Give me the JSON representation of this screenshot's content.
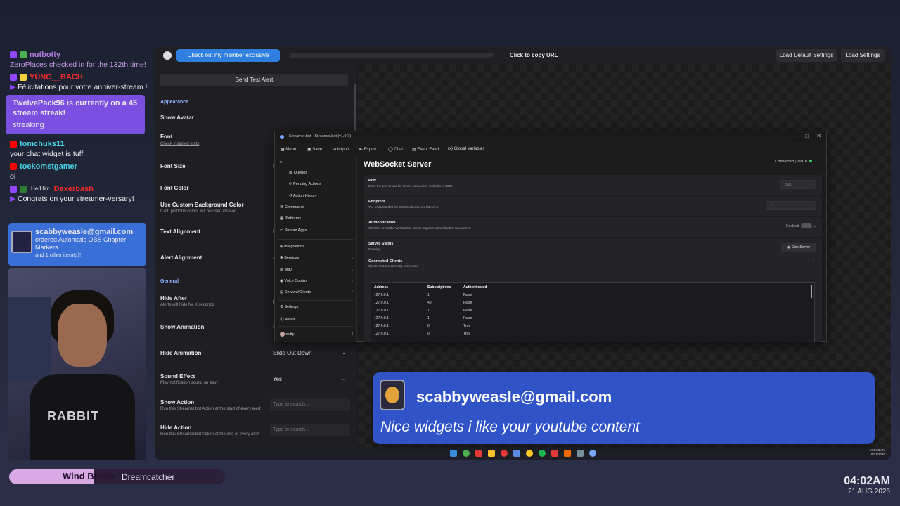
{
  "chat": {
    "messages": [
      {
        "user": "nutbotty",
        "user_color": "#b47be0",
        "platform": "twitch",
        "text": "ZeroPlaces checked in for the 132th time!",
        "text_color": "#c89ce8"
      },
      {
        "user": "YUNG__BACH",
        "user_color": "#ff2a2a",
        "platform": "twitch",
        "text": "Félicitations pour votre anniver-stream !",
        "emote": "party-emote"
      },
      {
        "event": true,
        "bold": "TwelvePack96 is currently on a 45 stream streak!",
        "plain": "streaking"
      },
      {
        "user": "tomchuks11",
        "user_color": "#49d3e6",
        "platform": "youtube",
        "text": "your chat widget is tuff"
      },
      {
        "user": "toekomstgamer",
        "user_color": "#49d3e6",
        "platform": "youtube",
        "text": "oi"
      },
      {
        "user": "Dexerbash",
        "user_color": "#ff2a2a",
        "platform": "twitch",
        "pronoun": "He/Him",
        "text": "Congrats on your streamer-versary!",
        "emote": "party-emote"
      }
    ],
    "order": {
      "email": "scabbyweasle@gmail.com",
      "item": "ordered Automatic OBS Chapter Markers",
      "extra": "and 1 other item(s)!"
    }
  },
  "music": {
    "song": "Wind Blows",
    "artist": "Dreamcatcher",
    "progress": 0.39
  },
  "clock": {
    "time": "04:02AM",
    "date": "21 AUG 2026"
  },
  "app": {
    "promo": "Check out my member exclusive widgets!",
    "copy_url": "Click to copy URL",
    "load_default": "Load Default Settings",
    "load": "Load Settings",
    "send_test": "Send Test Alert",
    "sections": {
      "appearance": "Appearance",
      "general": "General"
    },
    "fields": {
      "show_avatar": "Show Avatar",
      "font": "Font",
      "font_sub": "Check installed fonts",
      "font_size": "Font Size",
      "font_size_val": "5",
      "font_color": "Font Color",
      "custom_bg": "Use Custom Background Color",
      "custom_bg_sub": "If off, platform colors will be used instead",
      "text_align": "Text Alignment",
      "text_align_val": "L",
      "alert_align": "Alert Alignment",
      "alert_align_val": "A",
      "hide_after": "Hide After",
      "hide_after_sub": "Alerts will hide for X seconds",
      "hide_after_val": "8",
      "show_anim": "Show Animation",
      "show_anim_val": "S",
      "hide_anim": "Hide Animation",
      "hide_anim_val": "Slide Out Down",
      "sound": "Sound Effect",
      "sound_sub": "Play notification sound on alert",
      "sound_val": "Yes",
      "show_action": "Show Action",
      "show_action_sub": "Run this Streamer.bot Action at the start of every alert",
      "hide_action": "Hide Action",
      "hide_action_sub": "Run this Streamer.bot Action at the end of every alert",
      "search_ph": "Type to search..."
    }
  },
  "streamerbot": {
    "title": "Streamer.bot - Streamer.bot (v1.0.7)",
    "menu": [
      "Menu",
      "Save",
      "Import",
      "Export",
      "Chat",
      "Event Feed",
      "Global Variables"
    ],
    "connected": "Connected (10/10)",
    "nav": [
      "Queues",
      "Pending Actions",
      "Action History",
      "Commands",
      "Platforms",
      "Stream Apps",
      "Integrations",
      "Services",
      "MIDI",
      "Voice Control",
      "Servers/Clients",
      "Settings",
      "About"
    ],
    "user": "nutty",
    "page_title": "WebSocket Server",
    "port": {
      "label": "Port",
      "sub": "Enter the port to use for server connection. Defaults to 8080",
      "value": "8080"
    },
    "endpoint": {
      "label": "Endpoint",
      "sub": "The endpoint that the WebSocket server listens on",
      "value": "/"
    },
    "auth": {
      "label": "Authentication",
      "sub": "Whether or not the WebSocket server requires authentication to connect",
      "value": "Enabled"
    },
    "status": {
      "label": "Server Status",
      "sub": "Running",
      "button": "Stop Server"
    },
    "clients": {
      "label": "Connected Clients",
      "sub": "Clients that are currently connected",
      "headers": [
        "Address",
        "Subscriptions",
        "Authenticated"
      ],
      "rows": [
        [
          "127.0.0.1",
          "1",
          "False"
        ],
        [
          "127.0.0.1",
          "40",
          "False"
        ],
        [
          "127.0.0.1",
          "1",
          "False"
        ],
        [
          "127.0.0.1",
          "1",
          "False"
        ],
        [
          "127.0.0.1",
          "0",
          "True"
        ],
        [
          "127.0.0.1",
          "0",
          "True"
        ]
      ]
    }
  },
  "popup": {
    "name": "scabbyweasle@gmail.com",
    "message": "Nice widgets i like your youtube content"
  },
  "tray": {
    "time": "4:02:53 AM",
    "date": "8/21/2026"
  },
  "colors": {
    "accent": "#3a8bf0",
    "popup": "#3054c8",
    "event": "#7b4fe0",
    "order": "#3a6fd8"
  }
}
